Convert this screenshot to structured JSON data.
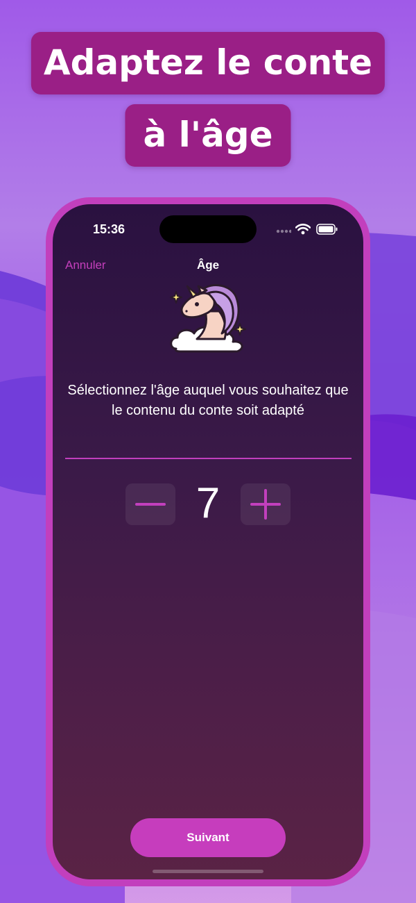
{
  "headline": {
    "line1": "Adaptez le conte",
    "line2": "à l'âge"
  },
  "status_bar": {
    "time": "15:36"
  },
  "nav": {
    "cancel_label": "Annuler",
    "title": "Âge"
  },
  "prompt": "Sélectionnez l'âge auquel vous souhaitez que le contenu du conte soit adapté",
  "stepper": {
    "value": "7",
    "decrement_icon": "minus-icon",
    "increment_icon": "plus-icon"
  },
  "next_button_label": "Suivant",
  "colors": {
    "accent": "#c23fbd",
    "headline_pill": "#9a1f86",
    "screen_top": "#2a1140",
    "screen_bottom": "#5a2345"
  }
}
